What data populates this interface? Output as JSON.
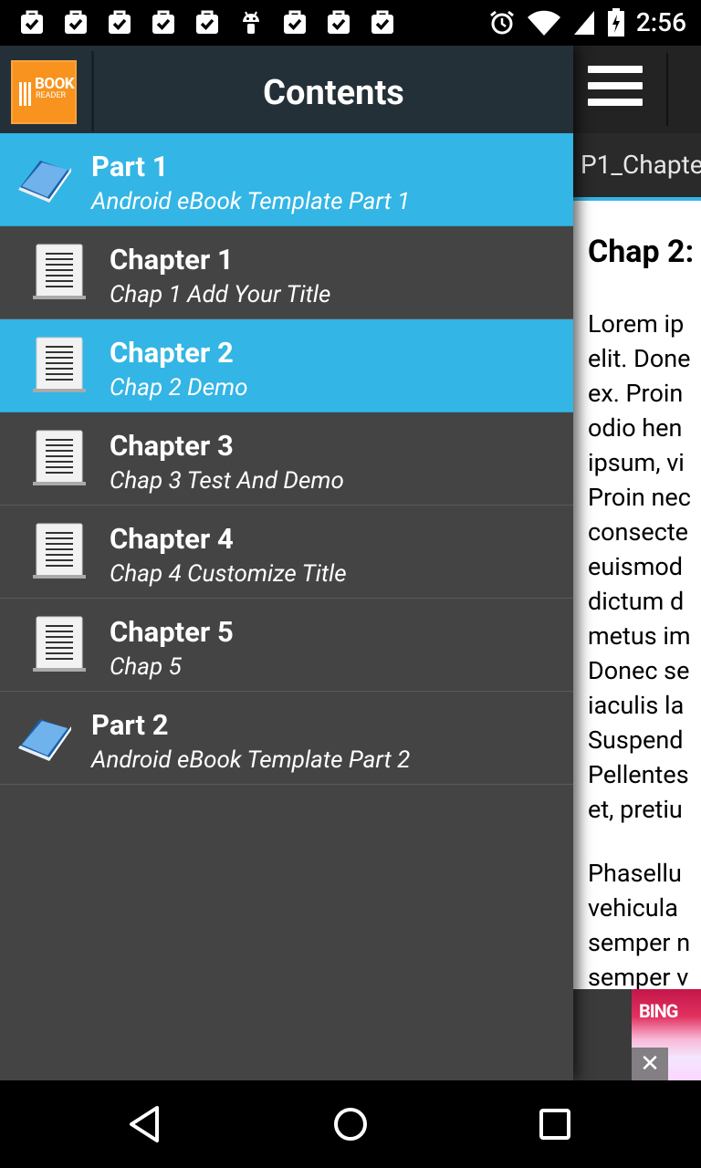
{
  "status_bar": {
    "time": "2:56",
    "notification_icons": [
      "checked-bag-icon",
      "checked-bag-icon",
      "checked-bag-icon",
      "checked-bag-icon",
      "checked-bag-icon",
      "android-icon",
      "checked-bag-icon",
      "checked-bag-icon",
      "checked-bag-icon"
    ]
  },
  "drawer": {
    "title": "Contents",
    "logo_text": "BOOK",
    "logo_subtext": "READER",
    "items": [
      {
        "type": "part",
        "title": "Part 1",
        "subtitle": "Android eBook Template Part 1",
        "selected": true
      },
      {
        "type": "chapter",
        "title": "Chapter 1",
        "subtitle": "Chap 1 Add Your Title",
        "selected": false
      },
      {
        "type": "chapter",
        "title": "Chapter 2",
        "subtitle": "Chap 2 Demo",
        "selected": true
      },
      {
        "type": "chapter",
        "title": "Chapter 3",
        "subtitle": "Chap 3 Test And Demo",
        "selected": false
      },
      {
        "type": "chapter",
        "title": "Chapter 4",
        "subtitle": "Chap 4 Customize Title",
        "selected": false
      },
      {
        "type": "chapter",
        "title": "Chapter 5",
        "subtitle": "Chap 5",
        "selected": false
      },
      {
        "type": "part",
        "title": "Part 2",
        "subtitle": "Android eBook Template Part 2",
        "selected": false
      }
    ]
  },
  "reader": {
    "tab_label": "P1_Chapte",
    "heading": "Chap 2:",
    "paragraph1_lines": [
      "Lorem ip",
      "elit. Done",
      "ex. Proin",
      "odio hen",
      "ipsum, vi",
      "Proin nec",
      "consecte",
      "euismod",
      "dictum d",
      "metus im",
      "Donec se",
      "iaculis la",
      "Suspend",
      "Pellentes",
      "et, pretiu"
    ],
    "paragraph2_lines": [
      "Phasellu",
      "vehicula",
      "semper n",
      "semper v"
    ]
  },
  "ad": {
    "logo_text": "BING",
    "close_symbol": "✕"
  },
  "colors": {
    "accent": "#33b5e5",
    "drawer_bg": "#444444",
    "header_bg": "#243038",
    "logo_orange": "#f7931e"
  }
}
